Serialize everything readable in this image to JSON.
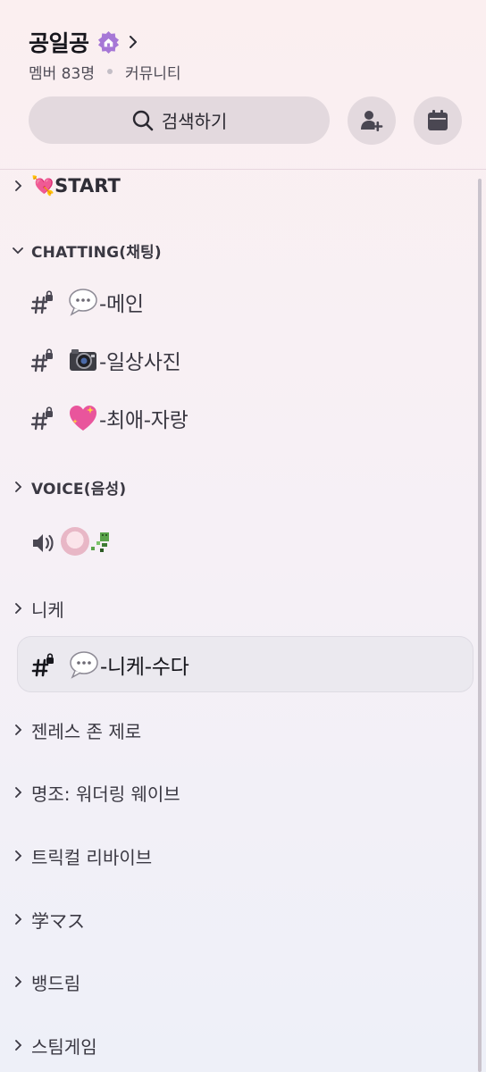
{
  "server": {
    "name": "공일공",
    "badge_icon": "home-badge-icon",
    "member_count": "멤버 83명",
    "type_label": "커뮤니티"
  },
  "actions": {
    "search_label": "검색하기",
    "invite_icon": "add-member-icon",
    "events_icon": "calendar-icon"
  },
  "channels": [
    {
      "kind": "category",
      "label": "💘START",
      "collapsed": true
    },
    {
      "kind": "category",
      "label": "CHATTING(채팅)",
      "collapsed": false
    },
    {
      "kind": "text",
      "emoji": "💬",
      "label": "-메인",
      "locked": true
    },
    {
      "kind": "text",
      "emoji": "📷",
      "label": "-일상사진",
      "locked": true
    },
    {
      "kind": "text",
      "emoji": "💖",
      "label": "-최애-자랑",
      "locked": true
    },
    {
      "kind": "category",
      "label": "VOICE(음성)",
      "collapsed": true
    },
    {
      "kind": "voice",
      "label": ""
    },
    {
      "kind": "category",
      "label": "니케",
      "collapsed": true
    },
    {
      "kind": "text",
      "emoji": "💬",
      "label": "-니케-수다",
      "locked": true,
      "active": true
    },
    {
      "kind": "category",
      "label": "젠레스 존 제로",
      "collapsed": true
    },
    {
      "kind": "category",
      "label": "명조: 워더링 웨이브",
      "collapsed": true
    },
    {
      "kind": "category",
      "label": "트릭컬 리바이브",
      "collapsed": true
    },
    {
      "kind": "category",
      "label": "学マス",
      "collapsed": true
    },
    {
      "kind": "category",
      "label": "뱅드림",
      "collapsed": true
    },
    {
      "kind": "category",
      "label": "스팀게임",
      "collapsed": true
    }
  ],
  "colors": {
    "accent_badge": "#a677d6",
    "button_bg": "#e3d9de",
    "active_row_bg": "#ebe9ef"
  }
}
